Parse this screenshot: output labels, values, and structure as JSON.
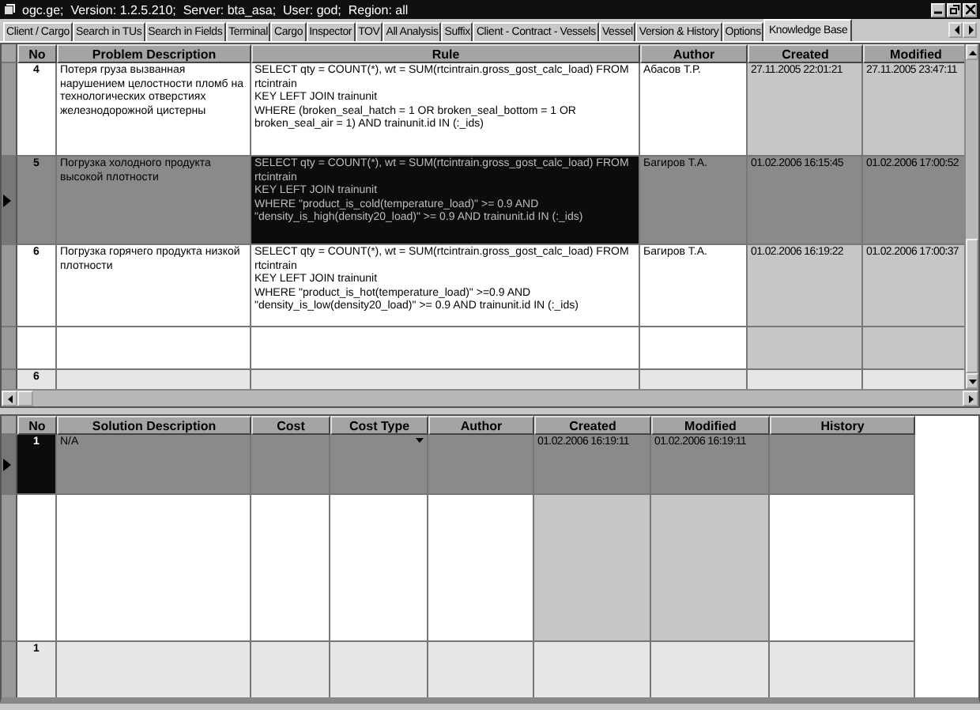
{
  "window": {
    "title": "ogc.ge;  Version: 1.2.5.210;  Server: bta_asa;  User: god;  Region: all"
  },
  "tabs": [
    {
      "label": "Client / Cargo",
      "selected": false
    },
    {
      "label": "Search in TUs",
      "selected": false
    },
    {
      "label": "Search in Fields",
      "selected": false
    },
    {
      "label": "Terminal",
      "selected": false
    },
    {
      "label": "Cargo",
      "selected": false
    },
    {
      "label": "Inspector",
      "selected": false
    },
    {
      "label": "TOV",
      "selected": false
    },
    {
      "label": "All Analysis",
      "selected": false
    },
    {
      "label": "Suffix",
      "selected": false
    },
    {
      "label": "Client - Contract - Vessels",
      "selected": false
    },
    {
      "label": "Vessel",
      "selected": false
    },
    {
      "label": "Version & History",
      "selected": false
    },
    {
      "label": "Options",
      "selected": false
    },
    {
      "label": "Knowledge Base",
      "selected": true
    }
  ],
  "problems_table": {
    "columns": [
      "No",
      "Problem Description",
      "Rule",
      "Author",
      "Created",
      "Modified"
    ],
    "rows": [
      {
        "selected": false,
        "cells": [
          "4",
          "Потеря груза вызванная нарушением целостности пломб на технологических отверстиях железнодорожной цистерны",
          "SELECT qty = COUNT(*), wt = SUM(rtcintrain.gross_gost_calc_load) FROM rtcintrain\nKEY LEFT JOIN trainunit\nWHERE (broken_seal_hatch = 1 OR broken_seal_bottom = 1 OR broken_seal_air = 1) AND trainunit.id IN (:_ids)",
          "Абасов Т.Р.",
          "27.11.2005 22:01:21",
          "27.11.2005 23:47:11"
        ]
      },
      {
        "selected": true,
        "cells": [
          "5",
          "Погрузка холодного продукта высокой плотности",
          "SELECT qty = COUNT(*), wt = SUM(rtcintrain.gross_gost_calc_load) FROM rtcintrain\nKEY LEFT JOIN trainunit\nWHERE \"product_is_cold(temperature_load)\" >= 0.9 AND \"density_is_high(density20_load)\" >= 0.9 AND trainunit.id IN (:_ids)",
          "Багиров Т.А.",
          "01.02.2006 16:15:45",
          "01.02.2006 17:00:52"
        ]
      },
      {
        "selected": false,
        "cells": [
          "6",
          "Погрузка горячего продукта низкой плотности",
          "SELECT qty = COUNT(*), wt = SUM(rtcintrain.gross_gost_calc_load) FROM rtcintrain\nKEY LEFT JOIN trainunit\nWHERE \"product_is_hot(temperature_load)\" >=0.9 AND \"density_is_low(density20_load)\" >= 0.9 AND trainunit.id IN (:_ids)",
          "Багиров Т.А.",
          "01.02.2006 16:19:22",
          "01.02.2006 17:00:37"
        ]
      }
    ],
    "footer": "6"
  },
  "solutions_table": {
    "columns": [
      "No",
      "Solution Description",
      "Cost",
      "Cost Type",
      "Author",
      "Created",
      "Modified",
      "History"
    ],
    "rows": [
      {
        "selected": true,
        "cells": [
          "1",
          "N/A",
          "",
          "",
          "",
          "01.02.2006 16:19:11",
          "01.02.2006 16:19:11",
          ""
        ]
      }
    ],
    "footer": "1"
  }
}
